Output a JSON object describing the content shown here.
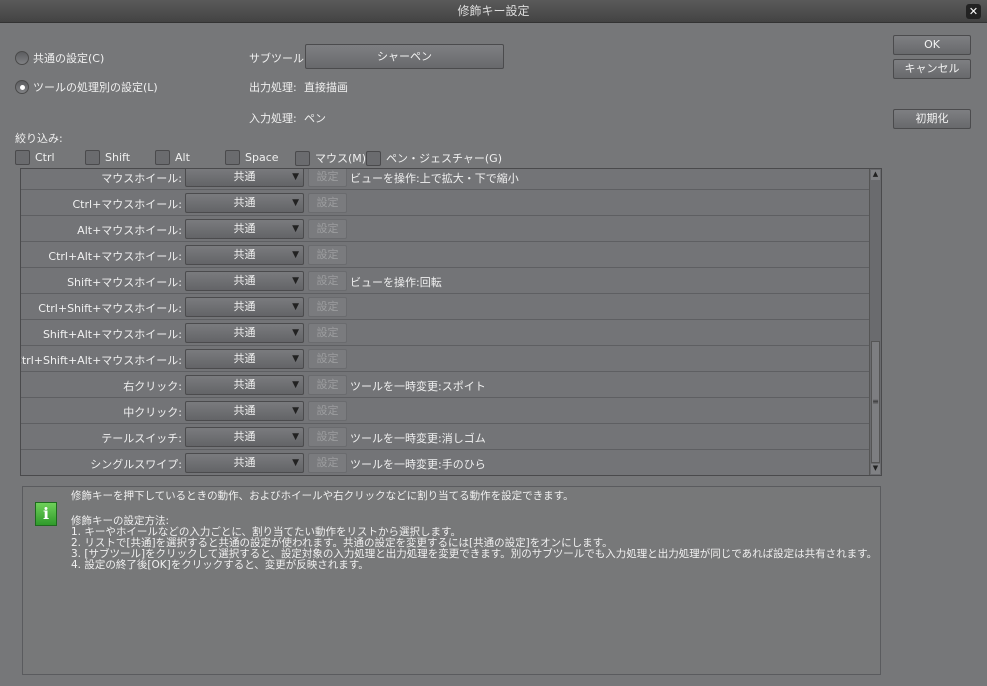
{
  "title": "修飾キー設定",
  "mode": {
    "common": "共通の設定(C)",
    "per_tool": "ツールの処理別の設定(L)",
    "selected": "per_tool"
  },
  "subtool": {
    "label": "サブツール:",
    "value": "シャーペン"
  },
  "output": {
    "label": "出力処理:",
    "value": "直接描画"
  },
  "input": {
    "label": "入力処理:",
    "value": "ペン"
  },
  "filter": {
    "label": "絞り込み:",
    "options": [
      "Ctrl",
      "Shift",
      "Alt",
      "Space",
      "マウス(M)",
      "ペン・ジェスチャー(G)"
    ]
  },
  "set_label": "設定",
  "rows": [
    {
      "key": "マウスホイール:",
      "value": "共通",
      "action": "ビューを操作:上で拡大・下で縮小"
    },
    {
      "key": "Ctrl+マウスホイール:",
      "value": "共通",
      "action": ""
    },
    {
      "key": "Alt+マウスホイール:",
      "value": "共通",
      "action": ""
    },
    {
      "key": "Ctrl+Alt+マウスホイール:",
      "value": "共通",
      "action": ""
    },
    {
      "key": "Shift+マウスホイール:",
      "value": "共通",
      "action": "ビューを操作:回転"
    },
    {
      "key": "Ctrl+Shift+マウスホイール:",
      "value": "共通",
      "action": ""
    },
    {
      "key": "Shift+Alt+マウスホイール:",
      "value": "共通",
      "action": ""
    },
    {
      "key": "Ctrl+Shift+Alt+マウスホイール:",
      "value": "共通",
      "action": ""
    },
    {
      "key": "右クリック:",
      "value": "共通",
      "action": "ツールを一時変更:スポイト"
    },
    {
      "key": "中クリック:",
      "value": "共通",
      "action": ""
    },
    {
      "key": "テールスイッチ:",
      "value": "共通",
      "action": "ツールを一時変更:消しゴム"
    },
    {
      "key": "シングルスワイプ:",
      "value": "共通",
      "action": "ツールを一時変更:手のひら"
    }
  ],
  "buttons": {
    "ok": "OK",
    "cancel": "キャンセル",
    "reset": "初期化"
  },
  "info": {
    "lines": [
      "修飾キーを押下しているときの動作、およびホイールや右クリックなどに割り当てる動作を設定できます。",
      "修飾キーの設定方法:",
      "1. キーやホイールなどの入力ごとに、割り当てたい動作をリストから選択します。",
      "2. リストで[共通]を選択すると共通の設定が使われます。共通の設定を変更するには[共通の設定]をオンにします。",
      "3. [サブツール]をクリックして選択すると、設定対象の入力処理と出力処理を変更できます。別のサブツールでも入力処理と出力処理が同じであれば設定は共有されます。",
      "4. 設定の終了後[OK]をクリックすると、変更が反映されます。"
    ]
  }
}
